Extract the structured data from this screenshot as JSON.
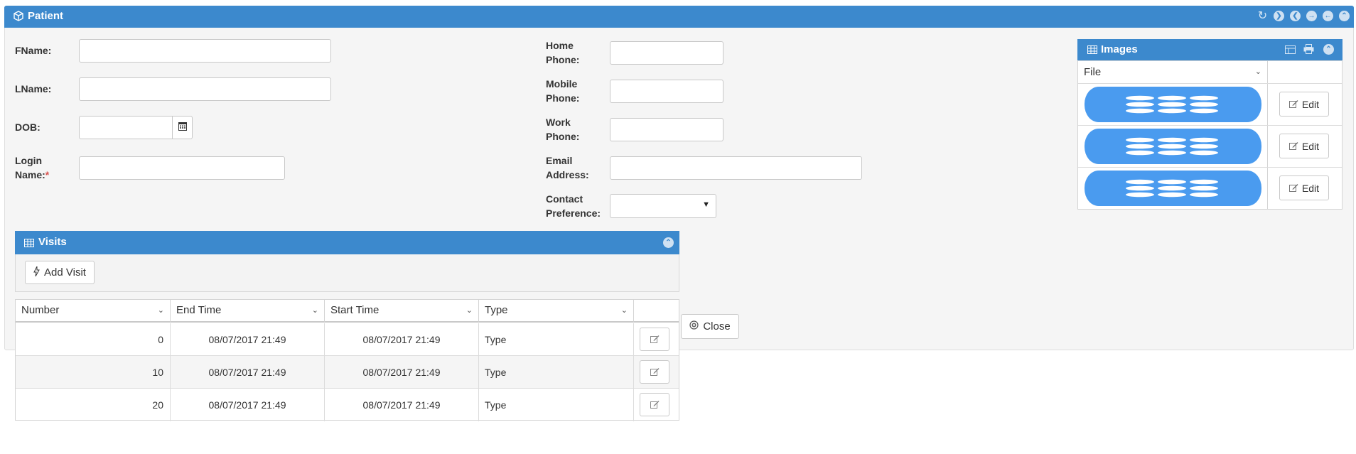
{
  "patient_panel": {
    "title": "Patient",
    "icons": [
      "refresh-icon",
      "chevron-right-circle-icon",
      "arrow-left-circle-icon",
      "arrow-right-circle-icon",
      "arrow-left-circle-icon",
      "chevron-up-circle-icon"
    ]
  },
  "form": {
    "fname_label": "FName:",
    "lname_label": "LName:",
    "dob_label": "DOB:",
    "login_label_line1": "Login",
    "login_label_line2": "Name:",
    "required_mark": "*",
    "home_label_line1": "Home",
    "home_label_line2": "Phone:",
    "mobile_label_line1": "Mobile",
    "mobile_label_line2": "Phone:",
    "work_label_line1": "Work",
    "work_label_line2": "Phone:",
    "email_label_line1": "Email",
    "email_label_line2": "Address:",
    "contact_label_line1": "Contact",
    "contact_label_line2": "Preference:",
    "fname_value": "",
    "lname_value": "",
    "dob_value": "",
    "login_value": "",
    "home_value": "",
    "mobile_value": "",
    "work_value": "",
    "email_value": "",
    "contact_value": ""
  },
  "visits": {
    "title": "Visits",
    "add_button": "Add Visit",
    "columns": [
      "Number",
      "End Time",
      "Start Time",
      "Type"
    ],
    "rows": [
      {
        "number": "0",
        "end_time": "08/07/2017 21:49",
        "start_time": "08/07/2017 21:49",
        "type": "Type"
      },
      {
        "number": "10",
        "end_time": "08/07/2017 21:49",
        "start_time": "08/07/2017 21:49",
        "type": "Type"
      },
      {
        "number": "20",
        "end_time": "08/07/2017 21:49",
        "start_time": "08/07/2017 21:49",
        "type": "Type"
      }
    ]
  },
  "close_button": "Close",
  "images": {
    "title": "Images",
    "file_column": "File",
    "edit_label": "Edit",
    "rows": 3
  },
  "colors": {
    "header_blue": "#3c89cd",
    "image_blue": "#4a9bef",
    "panel_bg": "#f5f5f5",
    "required_red": "#d9534f"
  }
}
